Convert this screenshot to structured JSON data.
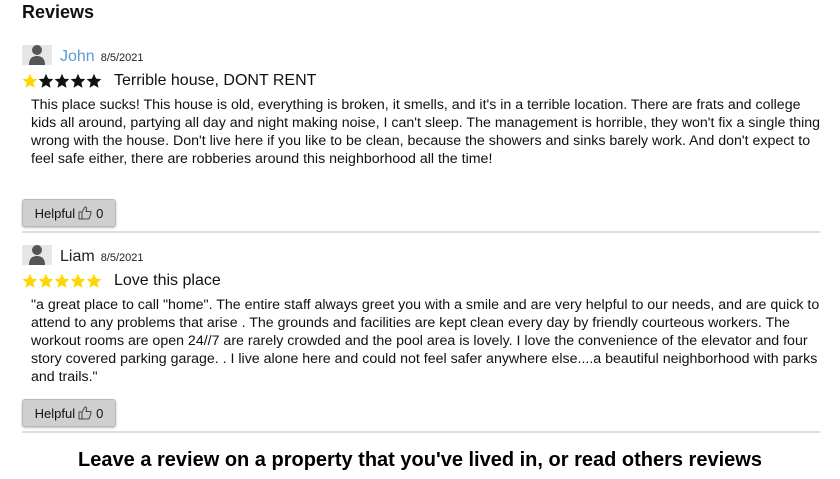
{
  "page": {
    "title": "Reviews"
  },
  "reviews": [
    {
      "name": "John",
      "date": "8/5/2021",
      "rating": 1,
      "max_rating": 5,
      "title": "Terrible house, DONT RENT",
      "text": "This place sucks! This house is old, everything is broken, it smells, and it's in a terrible location. There are frats and college kids all around, partying all day and night making noise, I can't sleep. The management is horrible, they won't fix a single thing wrong with the house. Don't live here if you like to be clean, because the showers and sinks barely work. And don't expect to feel safe either, there are robberies around this neighborhood all the time!",
      "helpful_label": "Helpful",
      "helpful_count": "0"
    },
    {
      "name": "Liam",
      "date": "8/5/2021",
      "rating": 5,
      "max_rating": 5,
      "title": "Love this place",
      "text": "\"a great place to call \"home\". The entire staff always greet you with a smile and are very helpful to our needs, and are quick to attend to any problems that arise . The grounds and facilities are kept clean every day by friendly courteous workers. The workout rooms are open 24//7 are rarely crowded and the pool area is lovely. I love the convenience of the elevator and four story covered parking garage. . I live alone here and could not feel safer anywhere else....a beautiful neighborhood with parks and trails.\"",
      "helpful_label": "Helpful",
      "helpful_count": "0"
    }
  ],
  "footer": {
    "text": "Leave a review on a property that you've lived in, or read others reviews"
  },
  "colors": {
    "star_filled": "#ffd700",
    "star_empty": "#111111",
    "name_link": "#5b9bd5"
  },
  "icons": {
    "avatar": "user-silhouette-icon",
    "thumb": "thumbs-up-icon",
    "star": "star-icon"
  }
}
